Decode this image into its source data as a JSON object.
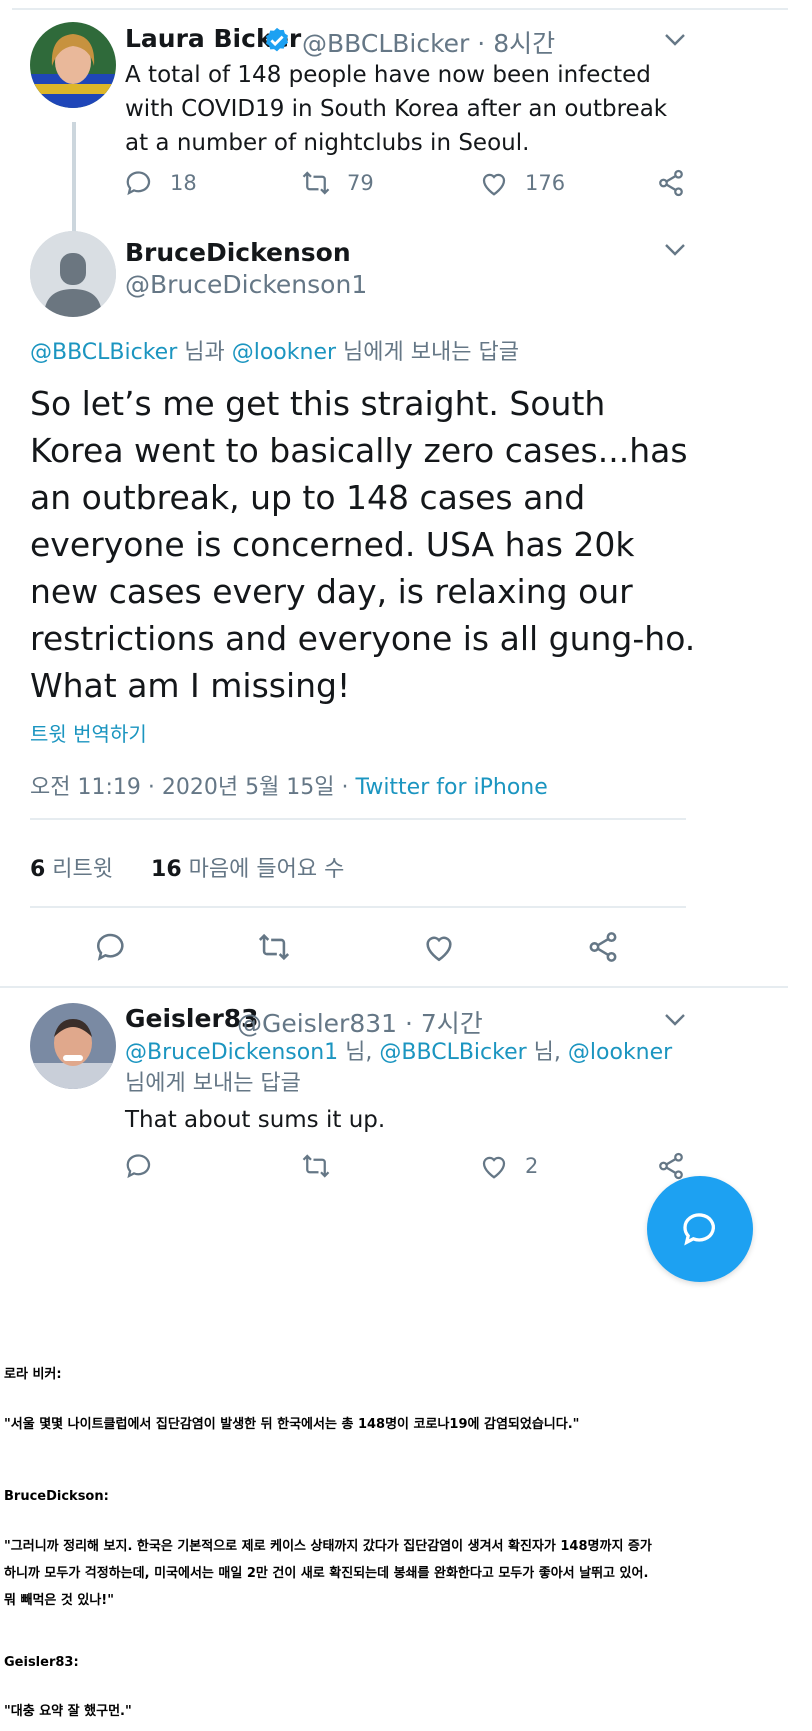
{
  "tweet1": {
    "name": "Laura Bicker",
    "handle": "@BBCLBicker",
    "time": "· 8시간",
    "text": "A total of 148 people have now been infected with COVID19 in South Korea after an outbreak at a number of nightclubs in Seoul.",
    "replies": "18",
    "retweets": "79",
    "likes": "176"
  },
  "tweet2": {
    "name": "BruceDickenson",
    "handle": "@BruceDickenson1",
    "reply_to_mention1": "@BBCLBicker",
    "reply_to_mid": " 님과 ",
    "reply_to_mention2": "@lookner",
    "reply_to_tail": " 님에게 보내는 답글",
    "text": "So let’s me get this straight. South Korea went to basically zero cases...has an outbreak, up to 148 cases and everyone is concerned. USA has 20k new cases every day, is relaxing our restrictions and everyone is all gung-ho. What am I missing!",
    "translate": "트윗 번역하기",
    "timestamp": "오전 11:19 · 2020년 5월 15일 · ",
    "source": "Twitter for iPhone",
    "retweet_count": "6",
    "retweet_label": " 리트윗",
    "like_count": "16",
    "like_label": " 마음에 들어요 수"
  },
  "tweet3": {
    "name": "Geisler83",
    "handle": "@Geisler831",
    "time": "· 7시간",
    "mention1": "@BruceDickenson1",
    "sep1": " 님, ",
    "mention2": "@BBCLBicker",
    "sep2": " 님, ",
    "mention3": "@lookner",
    "tail": " 님에게 보내는 답글",
    "text": "That about sums it up.",
    "likes": "2"
  },
  "translation": {
    "speaker1": "로라 비커:",
    "quote1": "\"서울 몇몇 나이트클럽에서 집단감염이 발생한 뒤 한국에서는 총 148명이 코로나19에 감염되었습니다.\"",
    "speaker2": "BruceDickson:",
    "quote2_line1": "\"그러니까 정리해 보지. 한국은 기본적으로 제로 케이스 상태까지 갔다가 집단감염이 생겨서 확진자가 148명까지 증가",
    "quote2_line2": "하니까 모두가 걱정하는데, 미국에서는 매일 2만 건이 새로 확진되는데 봉쇄를 완화한다고 모두가 좋아서 날뛰고 있어.",
    "quote2_line3": "뭐 빼먹은 것 있나!\"",
    "speaker3": "Geisler83:",
    "quote3": "\"대충 요약 잘 했구먼.\""
  },
  "colors": {
    "accent": "#1b95c0",
    "fab": "#1da1f2",
    "secondary_text": "#657786",
    "verified": "#1da1f2"
  },
  "icons": [
    "chevron-down-icon",
    "reply-icon",
    "retweet-icon",
    "like-icon",
    "share-icon",
    "verified-badge-icon",
    "compose-icon"
  ]
}
